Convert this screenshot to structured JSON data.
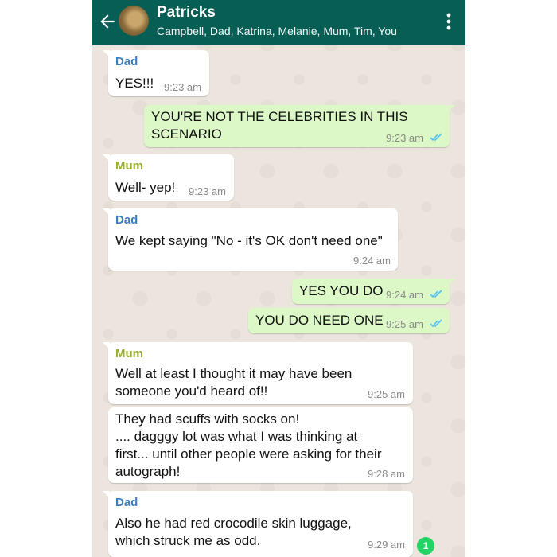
{
  "header": {
    "title": "Patricks",
    "members": "Campbell, Dad, Katrina, Melanie, Mum, Tim, You"
  },
  "messages": [
    {
      "dir": "in",
      "sender": "Dad",
      "text": "YES!!!",
      "time": "9:23 am"
    },
    {
      "dir": "out",
      "text": "YOU'RE NOT THE CELEBRITIES IN THIS\nSCENARIO",
      "time": "9:23 am",
      "status": "read"
    },
    {
      "dir": "in",
      "sender": "Mum",
      "text": "Well- yep!",
      "time": "9:23 am"
    },
    {
      "dir": "in",
      "sender": "Dad",
      "text": "We kept saying \"No - it's OK don't need one\"",
      "time": "9:24 am"
    },
    {
      "dir": "out",
      "text": "YES YOU DO",
      "time": "9:24 am",
      "status": "read"
    },
    {
      "dir": "out",
      "text": "YOU DO NEED ONE",
      "time": "9:25 am",
      "status": "read"
    },
    {
      "dir": "in",
      "sender": "Mum",
      "text": "Well at least I thought it may have been\nsomeone you'd heard of!!",
      "time": "9:25 am"
    },
    {
      "dir": "in",
      "text": "They had scuffs with socks on!\n.... dagggy lot was what I was thinking at\nfirst... until other people were asking for their\nautograph!",
      "time": "9:28 am"
    },
    {
      "dir": "in",
      "sender": "Dad",
      "text": "Also he had red crocodile skin luggage,\nwhich struck me as odd.",
      "time": "9:29 am"
    }
  ],
  "unread_count": "1",
  "colors": {
    "header": "#075e54",
    "outgoing": "#dcf8c6",
    "incoming": "#ffffff",
    "tick": "#4fc3f7"
  }
}
